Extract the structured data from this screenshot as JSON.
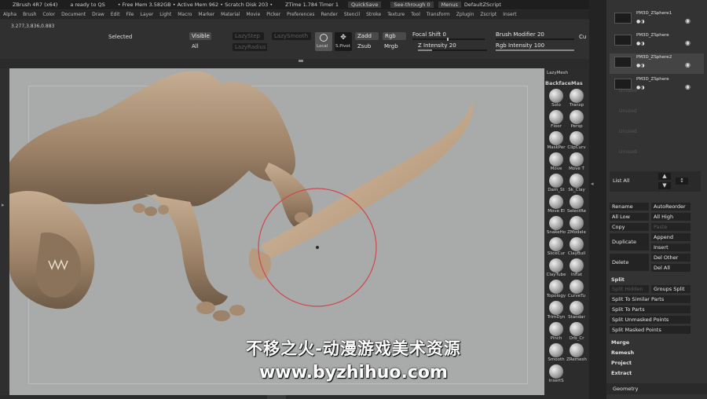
{
  "titlebar": {
    "app": "ZBrush 4R7 (x64)",
    "status": "a ready to QS",
    "mem": "• Free Mem 3.582GB • Active Mem 962 • Scratch Disk 203 •",
    "ztime": "ZTime 1.784 Timer 1",
    "quicksave": "QuickSave",
    "seethrough": "See-through 0",
    "menus": "Menus",
    "script": "DefaultZScript"
  },
  "menubar": [
    "Alpha",
    "Brush",
    "Color",
    "Document",
    "Draw",
    "Edit",
    "File",
    "Layer",
    "Light",
    "Macro",
    "Marker",
    "Material",
    "Movie",
    "Picker",
    "Preferences",
    "Render",
    "Stencil",
    "Stroke",
    "Texture",
    "Tool",
    "Transform",
    "Zplugin",
    "Zscript",
    "Insert"
  ],
  "shelf": {
    "coords": "3.277,3.836,0.883",
    "selected": "Selected",
    "visible": "Visible",
    "all": "All",
    "lazystep": "LazyStep",
    "lazysmooth": "LazySmooth",
    "lazyradius": "LazyRadius",
    "local": "Local",
    "sfirst": "S.Pivot",
    "zadd": "Zadd",
    "zsub": "Zsub",
    "rgb": "Rgb",
    "mrgb": "Mrgb",
    "focal_label": "Focal Shift",
    "focal_value": "0",
    "zint_label": "Z Intensity",
    "zint_value": "20",
    "brushmod_label": "Brush Modifier",
    "brushmod_value": "20",
    "rgbint_label": "Rgb Intensity",
    "rgbint_value": "100",
    "cu": "Cu"
  },
  "tools": {
    "lazymesh": "LazyMesh",
    "backface": "BackfaceMas",
    "items": [
      "Solo",
      "Transp",
      "Floor",
      "Persp",
      "MaskPer",
      "ClipCurv",
      "Move",
      "Move T",
      "Dam_St",
      "Sk_Clay",
      "Move El",
      "SelectRe",
      "SnakeHo",
      "ZModele",
      "SliceCur",
      "ClayBuil",
      "ClayTube",
      "Inflat",
      "Topology",
      "CurveTu",
      "TrimDyn",
      "Standar",
      "Pinch",
      "Orb_Cr",
      "Smooth",
      "ZRemesh",
      "InsertS"
    ]
  },
  "panel": {
    "subtools": [
      "PM3D_ZSphere1",
      "PM3D_ZSphere",
      "PM3D_ZSphere2",
      "PM3D_ZSphere"
    ],
    "empty_slots": [
      "Unused",
      "Unused",
      "Unused",
      "Unused"
    ],
    "list_all": "List All",
    "rename": "Rename",
    "autoreorder": "AutoReorder",
    "all_low": "All Low",
    "all_high": "All High",
    "copy": "Copy",
    "paste": "Paste",
    "duplicate": "Duplicate",
    "append": "Append",
    "insert": "Insert",
    "delete": "Delete",
    "del_other": "Del Other",
    "del_all": "Del All",
    "split": "Split",
    "split_hidden": "Split Hidden",
    "groups_split": "Groups Split",
    "split_similar": "Split To Similar Parts",
    "split_parts": "Split To Parts",
    "split_unmasked": "Split Unmasked Points",
    "split_masked": "Split Masked Points",
    "merge": "Merge",
    "remesh": "Remesh",
    "project": "Project",
    "extract": "Extract",
    "geometry": "Geometry"
  },
  "watermark": {
    "line1": "不移之火-动漫游戏美术资源",
    "line2": "www.byzhihuo.com"
  },
  "colors": {
    "viewport": "#a8aba9",
    "clay": "#a48a70",
    "brush_ring": "#d0474f"
  }
}
